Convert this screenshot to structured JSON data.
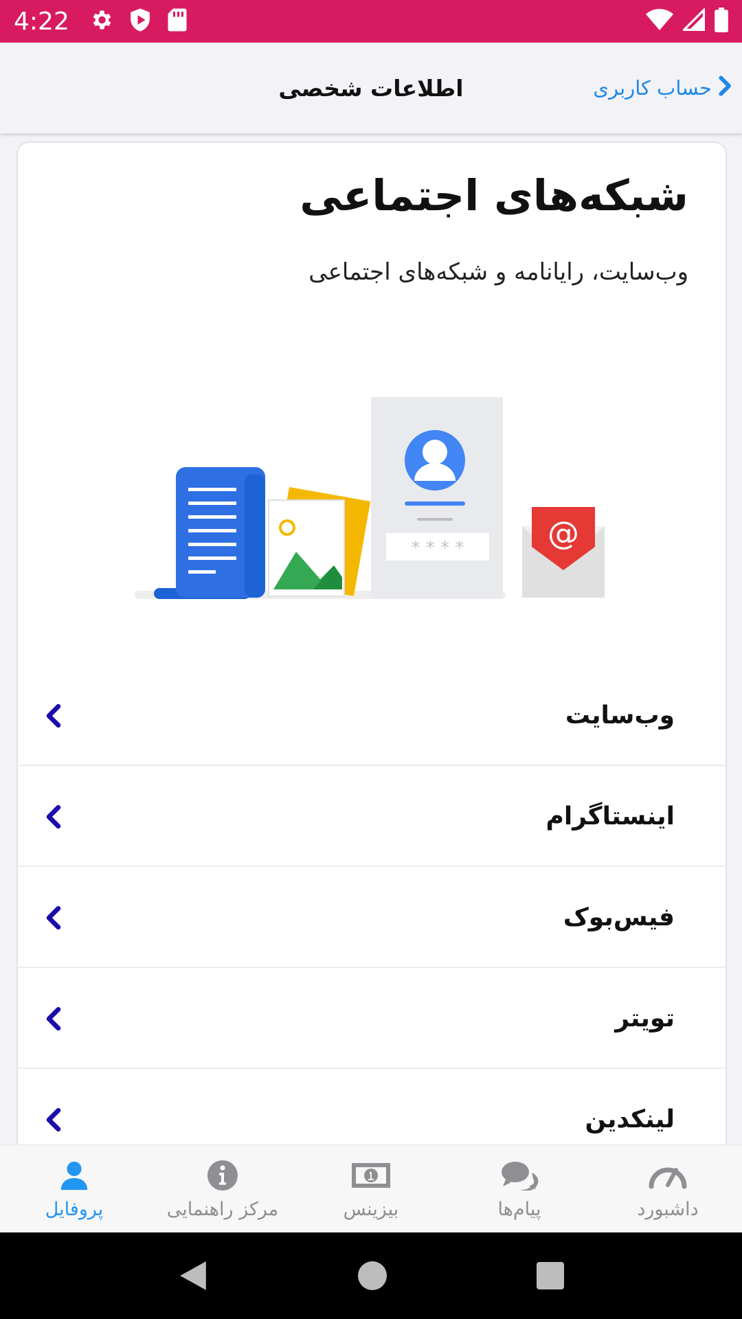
{
  "status_bar": {
    "time": "4:22"
  },
  "header": {
    "title": "اطلاعات شخصی",
    "back_label": "حساب کاربری"
  },
  "card": {
    "title": "شبکه‌های اجتماعی",
    "subtitle": "وب‌سایت، رایانامه و شبکه‌های اجتماعی",
    "illustration": {
      "password_mask": "* * * *",
      "email_symbol": "@"
    }
  },
  "list": [
    {
      "label": "وب‌سایت"
    },
    {
      "label": "اینستاگرام"
    },
    {
      "label": "فیس‌بوک"
    },
    {
      "label": "تویتر"
    },
    {
      "label": "لینکدین"
    }
  ],
  "tabs": {
    "profile": "پروفایل",
    "help_center": "مرکز راهنمایی",
    "business": "بیزینس",
    "messages": "پیام‌ها",
    "dashboard": "داشبورد"
  },
  "colors": {
    "status_bar": "#d81b60",
    "accent": "#2196f3",
    "link": "#1e88e5",
    "chevron": "#1a0dab"
  }
}
